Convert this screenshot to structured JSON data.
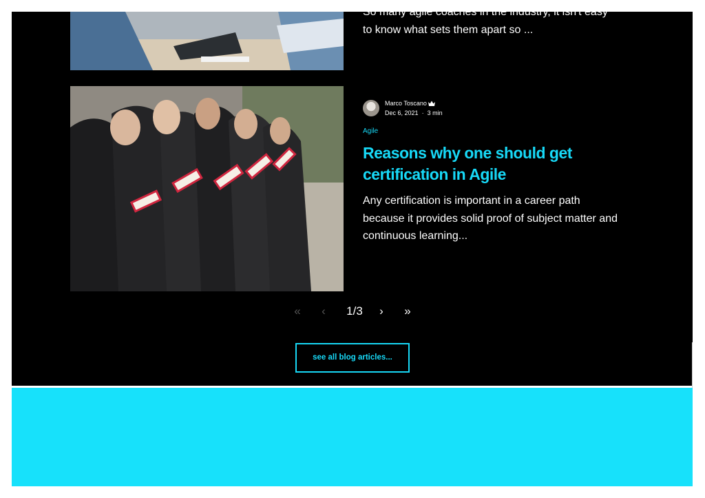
{
  "colors": {
    "accent": "#17d9f7",
    "dark_background": "#000000",
    "footer_band": "#17e1fb"
  },
  "posts": [
    {
      "excerpt": "So many agile coaches in the industry, it isn't easy to know what sets them apart so ..."
    },
    {
      "author": "Marco Toscano",
      "author_badge": "crown-icon",
      "date": "Dec 6, 2021",
      "separator": "·",
      "read_time": "3 min",
      "category": "Agile",
      "title": "Reasons why one should get certification in Agile",
      "excerpt": "Any certification is important in a career path because it provides solid proof of subject matter and continuous learning..."
    }
  ],
  "pagination": {
    "first": "«",
    "prev": "‹",
    "current": "1/3",
    "next": "›",
    "last": "»"
  },
  "see_all_label": "see all blog articles..."
}
